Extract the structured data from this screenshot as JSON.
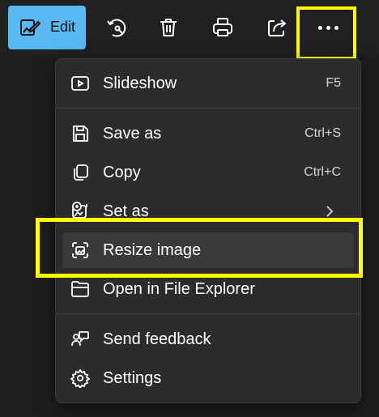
{
  "toolbar": {
    "edit_label": "Edit",
    "edit_color": "#57b8f2",
    "icons": [
      "rotate-icon",
      "delete-icon",
      "print-icon",
      "share-icon",
      "more-icon"
    ]
  },
  "highlight_color": "#ffff00",
  "menu": {
    "items": [
      {
        "label": "Slideshow",
        "shortcut": "F5",
        "icon": "slideshow-icon"
      },
      {
        "label": "Save as",
        "shortcut": "Ctrl+S",
        "icon": "save-icon"
      },
      {
        "label": "Copy",
        "shortcut": "Ctrl+C",
        "icon": "copy-icon"
      },
      {
        "label": "Set as",
        "shortcut": "",
        "icon": "set-as-icon",
        "submenu": true
      },
      {
        "label": "Resize image",
        "shortcut": "",
        "icon": "resize-icon",
        "highlighted": true
      },
      {
        "label": "Open in File Explorer",
        "shortcut": "",
        "icon": "folder-icon"
      },
      {
        "label": "Send feedback",
        "shortcut": "",
        "icon": "feedback-icon"
      },
      {
        "label": "Settings",
        "shortcut": "",
        "icon": "gear-icon"
      }
    ]
  }
}
